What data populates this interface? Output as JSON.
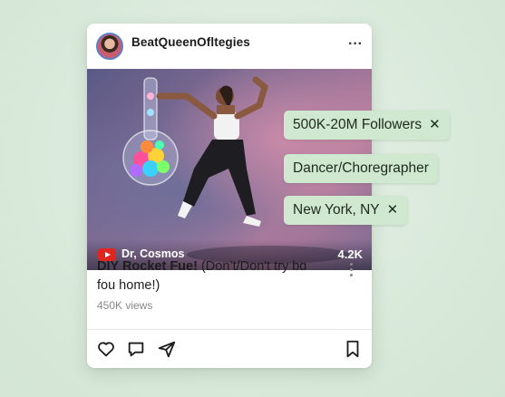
{
  "post": {
    "username": "BeatQueenOfltegies",
    "channel": "Dr, Cosmos",
    "media_count": "4.2K",
    "title_bold": "DIY Rocket Fue!",
    "title_rest": " (Don’t/Don't try bɑ fou home!)",
    "views": "450K views"
  },
  "icons": {
    "header_more": "more-horizontal-icon",
    "title_more": "more-vertical-icon",
    "like": "heart-icon",
    "comment": "comment-icon",
    "share": "send-icon",
    "save": "bookmark-icon",
    "play": "youtube-icon"
  },
  "tags": [
    {
      "label": "500K-20M Followers",
      "close": "✕"
    },
    {
      "label": "Dancer/Choregrapher",
      "close": ""
    },
    {
      "label": "New York, NY",
      "close": "✕"
    }
  ],
  "colors": {
    "background": "#dcebdd",
    "tag_bg": "#cfe8cf",
    "youtube_red": "#e0261f",
    "avatar_ring": "#5b7fc9"
  }
}
